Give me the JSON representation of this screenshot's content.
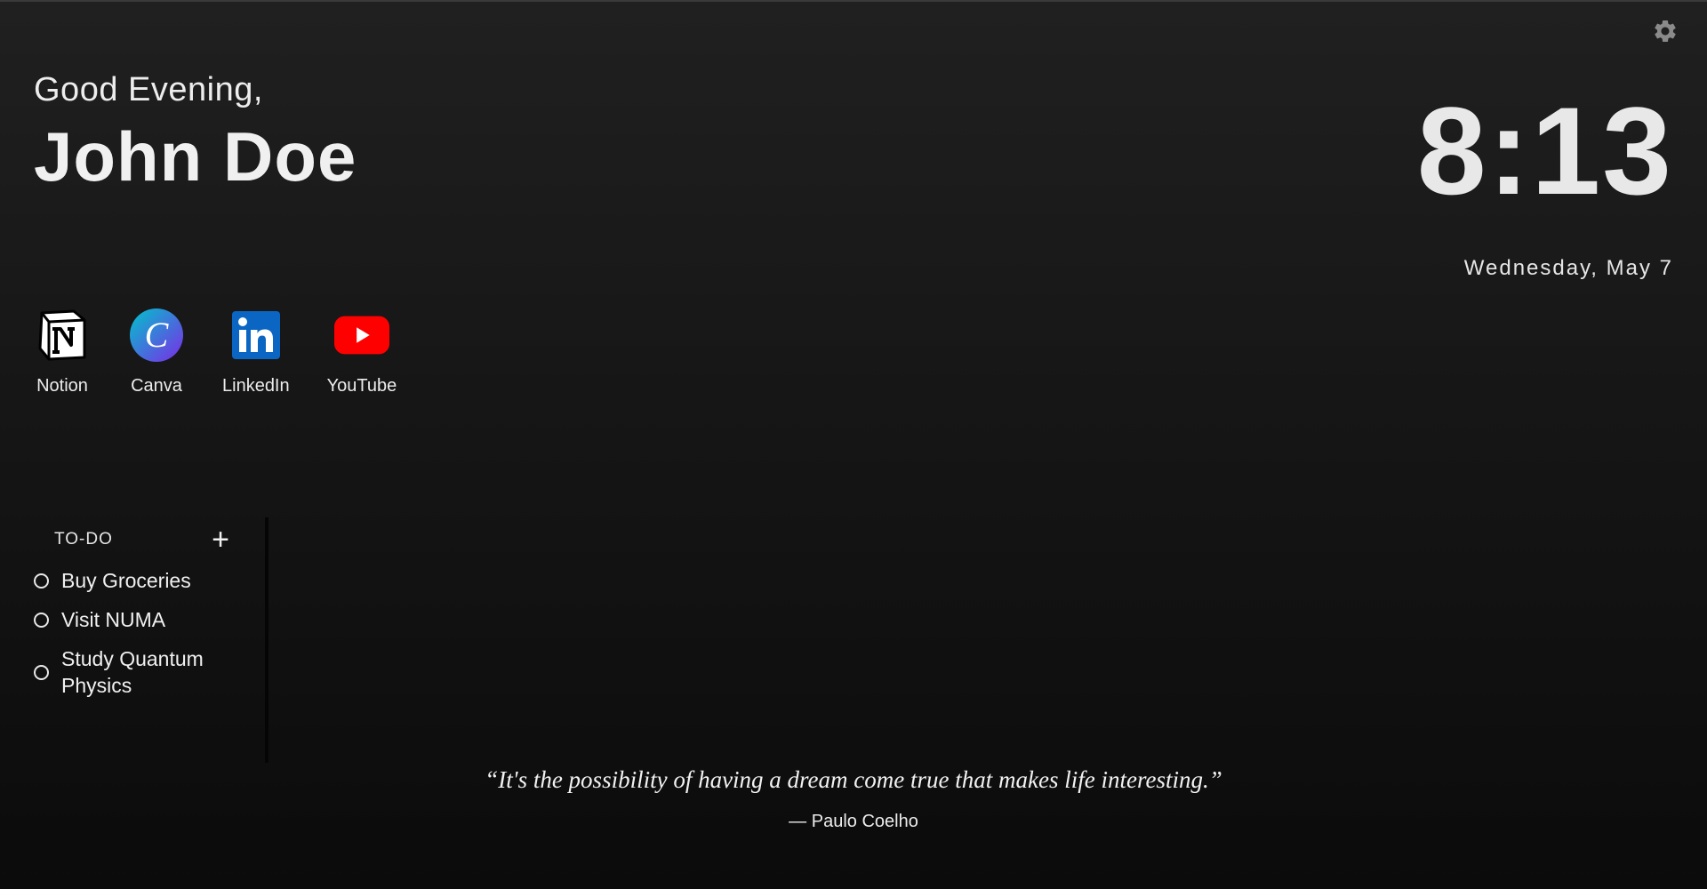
{
  "greeting": {
    "salutation": "Good Evening,",
    "name": "John Doe"
  },
  "clock": {
    "time": "8:13",
    "date": "Wednesday, May 7"
  },
  "shortcuts": [
    {
      "label": "Notion",
      "icon": "notion-icon"
    },
    {
      "label": "Canva",
      "icon": "canva-icon"
    },
    {
      "label": "LinkedIn",
      "icon": "linkedin-icon"
    },
    {
      "label": "YouTube",
      "icon": "youtube-icon"
    }
  ],
  "todo": {
    "title": "TO-DO",
    "add_label": "+",
    "items": [
      {
        "text": "Buy Groceries"
      },
      {
        "text": "Visit NUMA"
      },
      {
        "text": "Study Quantum Physics"
      }
    ]
  },
  "quote": {
    "text": "“It's the possibility of having a dream come true that makes life interesting.”",
    "author": "— Paulo Coelho"
  },
  "colors": {
    "linkedin": "#0a66c2",
    "youtube": "#ff0000",
    "canva_start": "#00c4cc",
    "canva_end": "#7d2ae8"
  }
}
